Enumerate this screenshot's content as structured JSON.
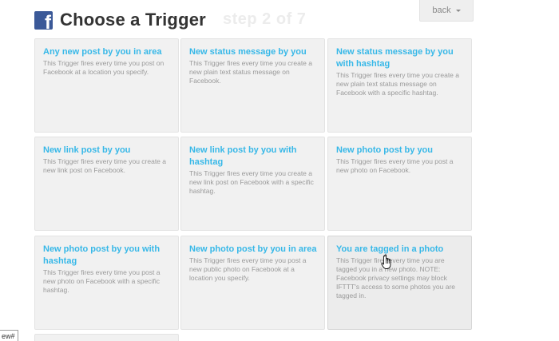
{
  "header": {
    "brand_icon": "facebook-icon",
    "brand_glyph": "f",
    "title": "Choose a Trigger",
    "step": "step 2 of 7",
    "back_label": "back"
  },
  "triggers": [
    {
      "title": "Any new post by you in area",
      "description": "This Trigger fires every time you post on Facebook at a location you specify."
    },
    {
      "title": "New status message by you",
      "description": "This Trigger fires every time you create a new plain text status message on Facebook."
    },
    {
      "title": "New status message by you with hashtag",
      "description": "This Trigger fires every time you create a new plain text status message on Facebook with a specific hashtag."
    },
    {
      "title": "New link post by you",
      "description": "This Trigger fires every time you create a new link post on Facebook."
    },
    {
      "title": "New link post by you with hashtag",
      "description": "This Trigger fires every time you create a new link post on Facebook with a specific hashtag."
    },
    {
      "title": "New photo post by you",
      "description": "This Trigger fires every time you post a new photo on Facebook."
    },
    {
      "title": "New photo post by you with hashtag",
      "description": "This Trigger fires every time you post a new photo on Facebook with a specific hashtag."
    },
    {
      "title": "New photo post by you in area",
      "description": "This Trigger fires every time you post a new public photo on Facebook at a location you specify."
    },
    {
      "title": "You are tagged in a photo",
      "description": "This Trigger fires every time you are tagged you in a new photo. NOTE: Facebook privacy settings may block IFTTT's access to some photos you are tagged in."
    }
  ],
  "corner_tag": "ew#",
  "cursor_icon": "hand-pointer-icon",
  "colors": {
    "facebook_blue": "#3b5998",
    "title_link": "#37b8e8",
    "tile_bg": "#f1f1f1"
  }
}
